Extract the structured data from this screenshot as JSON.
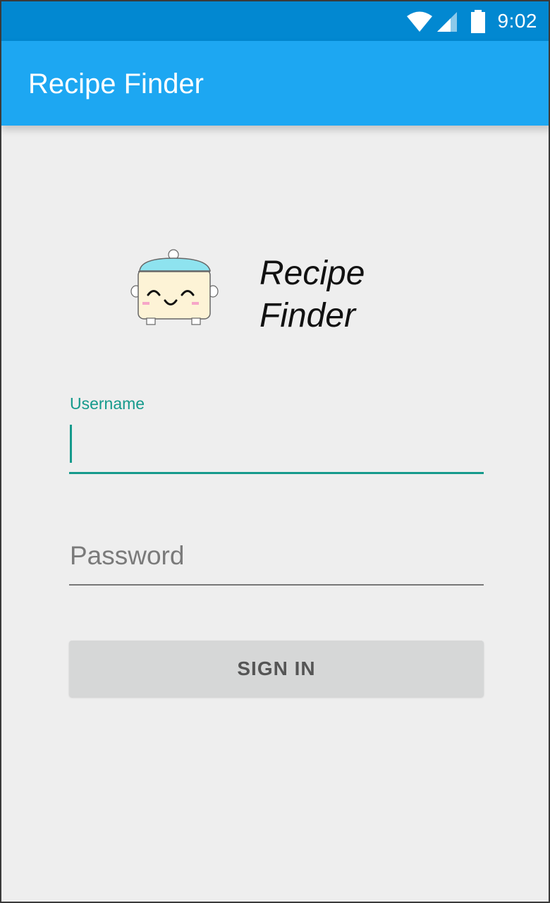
{
  "status_bar": {
    "time": "9:02",
    "icons": [
      "wifi-icon",
      "cell-signal-icon",
      "battery-icon"
    ]
  },
  "app_bar": {
    "title": "Recipe Finder"
  },
  "logo": {
    "icon": "cooking-pot-mascot-icon",
    "text_line1": "Recipe",
    "text_line2": "Finder"
  },
  "form": {
    "username": {
      "label": "Username",
      "value": ""
    },
    "password": {
      "placeholder": "Password",
      "value": ""
    },
    "sign_in_label": "SIGN IN"
  },
  "colors": {
    "status_bar": "#0288d1",
    "app_bar": "#1da7f2",
    "accent": "#159a8c",
    "background": "#eeeeee",
    "button": "#d6d7d7"
  }
}
